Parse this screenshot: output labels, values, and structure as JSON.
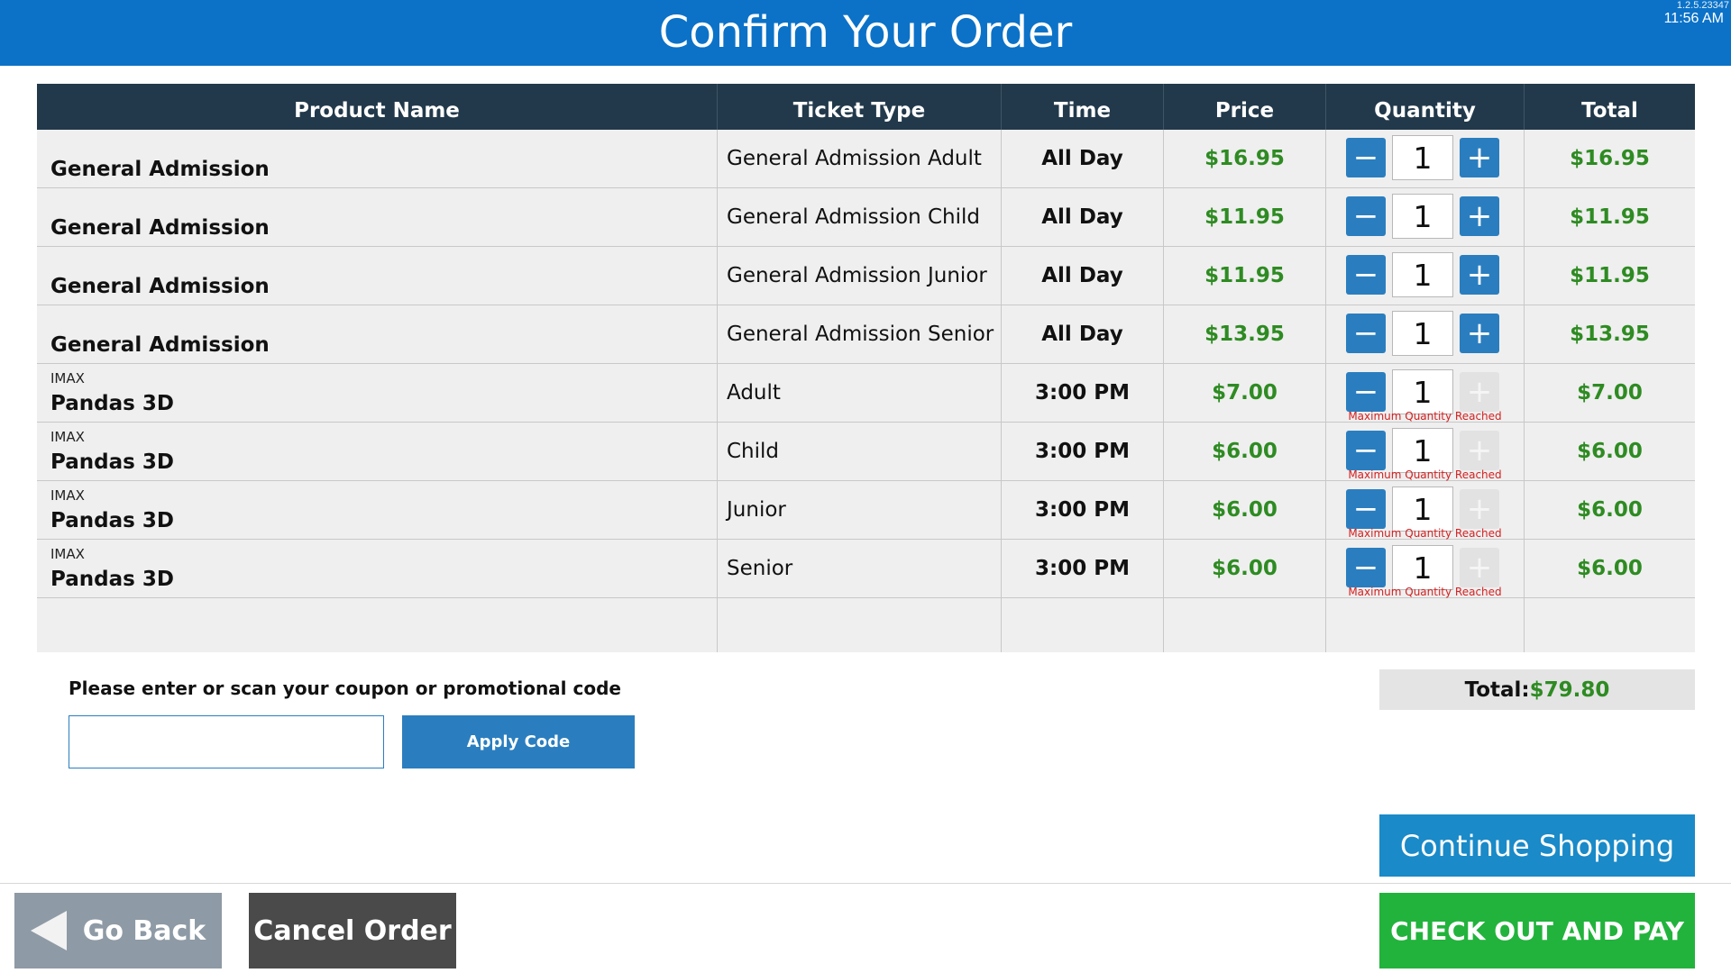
{
  "header": {
    "title": "Confirm Your Order",
    "version": "1.2.5.23347",
    "time": "11:56 AM",
    "background_color": "#0b72c8"
  },
  "table": {
    "columns": [
      "Product Name",
      "Ticket Type",
      "Time",
      "Price",
      "Quantity",
      "Total"
    ],
    "rows": [
      {
        "sub": "",
        "product": "General Admission",
        "ticket_type": "General Admission Adult",
        "time": "All Day",
        "price": "$16.95",
        "quantity": "1",
        "total": "$16.95",
        "plus_enabled": true,
        "message": ""
      },
      {
        "sub": "",
        "product": "General Admission",
        "ticket_type": "General Admission Child",
        "time": "All Day",
        "price": "$11.95",
        "quantity": "1",
        "total": "$11.95",
        "plus_enabled": true,
        "message": ""
      },
      {
        "sub": "",
        "product": "General Admission",
        "ticket_type": "General Admission Junior",
        "time": "All Day",
        "price": "$11.95",
        "quantity": "1",
        "total": "$11.95",
        "plus_enabled": true,
        "message": ""
      },
      {
        "sub": "",
        "product": "General Admission",
        "ticket_type": "General Admission Senior",
        "time": "All Day",
        "price": "$13.95",
        "quantity": "1",
        "total": "$13.95",
        "plus_enabled": true,
        "message": ""
      },
      {
        "sub": "IMAX",
        "product": "Pandas 3D",
        "ticket_type": "Adult",
        "time": "3:00 PM",
        "price": "$7.00",
        "quantity": "1",
        "total": "$7.00",
        "plus_enabled": false,
        "message": "Maximum Quantity Reached"
      },
      {
        "sub": "IMAX",
        "product": "Pandas 3D",
        "ticket_type": "Child",
        "time": "3:00 PM",
        "price": "$6.00",
        "quantity": "1",
        "total": "$6.00",
        "plus_enabled": false,
        "message": "Maximum Quantity Reached"
      },
      {
        "sub": "IMAX",
        "product": "Pandas 3D",
        "ticket_type": "Junior",
        "time": "3:00 PM",
        "price": "$6.00",
        "quantity": "1",
        "total": "$6.00",
        "plus_enabled": false,
        "message": "Maximum Quantity Reached"
      },
      {
        "sub": "IMAX",
        "product": "Pandas 3D",
        "ticket_type": "Senior",
        "time": "3:00 PM",
        "price": "$6.00",
        "quantity": "1",
        "total": "$6.00",
        "plus_enabled": false,
        "message": "Maximum Quantity Reached"
      }
    ],
    "minus_symbol": "−",
    "plus_symbol": "+"
  },
  "coupon": {
    "label": "Please enter or scan your coupon or promotional code",
    "input_value": "",
    "placeholder": "",
    "apply_label": "Apply Code"
  },
  "order_total": {
    "label": "Total:",
    "value": "$79.80"
  },
  "buttons": {
    "continue_shopping": "Continue Shopping",
    "go_back": "Go Back",
    "cancel_order": "Cancel Order",
    "checkout": "CHECK OUT AND PAY"
  },
  "colors": {
    "price_green": "#2e8b22",
    "table_header": "#22394b",
    "action_blue": "#2a7ebf",
    "checkout_green": "#22b33c",
    "warning_red": "#d42020"
  }
}
